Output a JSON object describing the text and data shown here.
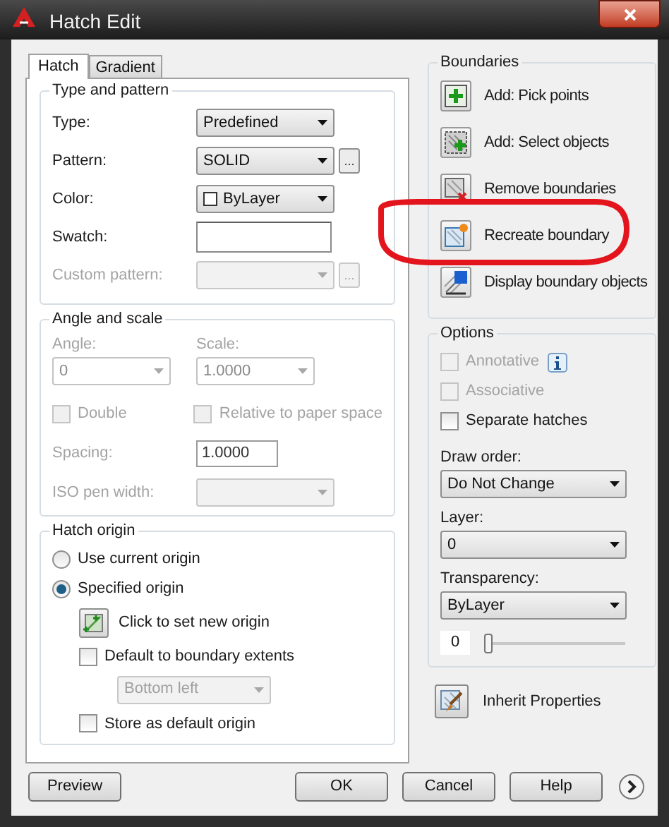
{
  "window": {
    "title": "Hatch Edit"
  },
  "tabs": [
    {
      "label": "Hatch",
      "selected": true
    },
    {
      "label": "Gradient",
      "selected": false
    }
  ],
  "type_and_pattern": {
    "title": "Type and pattern",
    "rows": [
      {
        "kind": "dropdown",
        "label": "Type:",
        "value": "Predefined",
        "disabled": false
      },
      {
        "kind": "dropdown",
        "label": "Pattern:",
        "value": "SOLID",
        "disabled": false,
        "browse": "..."
      },
      {
        "kind": "color",
        "label": "Color:",
        "value": "ByLayer",
        "disabled": false
      },
      {
        "kind": "swatch",
        "label": "Swatch:",
        "disabled": false
      },
      {
        "kind": "dropdown",
        "label": "Custom pattern:",
        "disabled": true,
        "browse": "..."
      }
    ]
  },
  "angle_and_scale": {
    "title": "Angle and scale",
    "angle": {
      "label": "Angle:",
      "value": "0",
      "disabled": true
    },
    "scale": {
      "label": "Scale:",
      "value": "1.0000",
      "disabled": true
    },
    "double": {
      "label": "Double",
      "checked": false,
      "disabled": true
    },
    "relative": {
      "label": "Relative to paper space",
      "checked": false,
      "disabled": true
    },
    "spacing": {
      "label": "Spacing:",
      "value": "1.0000",
      "disabled": true
    },
    "iso_pen_width": {
      "label": "ISO pen width:",
      "disabled": true
    }
  },
  "hatch_origin": {
    "title": "Hatch origin",
    "options": [
      {
        "label": "Use current origin",
        "selected": false
      },
      {
        "label": "Specified origin",
        "selected": true
      }
    ],
    "set_origin_button": "Click to set new origin",
    "default_to_extents": {
      "label": "Default to boundary extents",
      "checked": false,
      "disabled": false
    },
    "extents_position": {
      "value": "Bottom left",
      "disabled": true
    },
    "store_default": {
      "label": "Store as default origin",
      "checked": false,
      "disabled": false
    }
  },
  "boundaries": {
    "title": "Boundaries",
    "actions": [
      "Add: Pick points",
      "Add: Select objects",
      "Remove boundaries",
      "Recreate boundary",
      "Display boundary objects"
    ]
  },
  "options": {
    "title": "Options",
    "checks": [
      {
        "label": "Annotative",
        "checked": false,
        "disabled": true,
        "info": true
      },
      {
        "label": "Associative",
        "checked": false,
        "disabled": true,
        "info": false
      },
      {
        "label": "Separate hatches",
        "checked": false,
        "disabled": false,
        "info": false
      }
    ],
    "dropdowns": [
      {
        "label": "Draw order:",
        "value": "Do Not Change"
      },
      {
        "label": "Layer:",
        "value": "0"
      },
      {
        "label": "Transparency:",
        "value": "ByLayer"
      }
    ],
    "transparency_value": "0",
    "transparency_slider": {
      "level": 0
    }
  },
  "inherit_properties": "Inherit Properties",
  "buttons": {
    "left": [
      "Preview"
    ],
    "right": [
      "OK",
      "Cancel",
      "Help"
    ]
  }
}
